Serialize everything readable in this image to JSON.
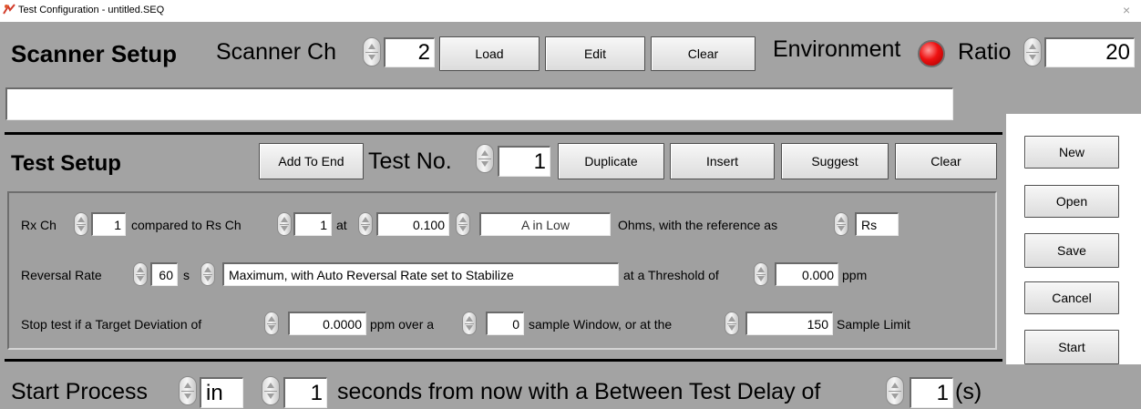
{
  "window": {
    "title": "Test Configuration - untitled.SEQ",
    "close_glyph": "×"
  },
  "scanner_setup": {
    "heading": "Scanner Setup",
    "scanner_ch_label": "Scanner Ch",
    "scanner_ch_value": "2",
    "load_label": "Load",
    "edit_label": "Edit",
    "clear_label": "Clear",
    "environment_label": "Environment",
    "environment_indicator_color": "#ee1111",
    "ratio_label": "Ratio",
    "ratio_value": "20",
    "description_value": ""
  },
  "test_setup": {
    "heading": "Test Setup",
    "add_to_end_label": "Add To End",
    "test_no_label": "Test No.",
    "test_no_value": "1",
    "duplicate_label": "Duplicate",
    "insert_label": "Insert",
    "suggest_label": "Suggest",
    "clear_label": "Clear",
    "row1": {
      "rx_ch_label": "Rx Ch",
      "rx_ch_value": "1",
      "compared_label": "compared to Rs Ch",
      "rs_ch_value": "1",
      "at_label": "at",
      "current_value": "0.100",
      "range_value": "A in Low",
      "ohms_label": "Ohms, with the reference as",
      "reference_value": "Rs"
    },
    "row2": {
      "reversal_rate_label": "Reversal Rate",
      "reversal_rate_value": "60",
      "s_label": "s",
      "mode_value": "Maximum, with Auto Reversal Rate set to Stabilize",
      "threshold_label": "at a Threshold of",
      "threshold_value": "0.000",
      "ppm_label": "ppm"
    },
    "row3": {
      "stop_label": "Stop test if a Target Deviation of",
      "deviation_value": "0.0000",
      "ppm_over_label": "ppm over a",
      "window_value": "0",
      "window_label": "sample Window, or at the",
      "limit_value": "150",
      "limit_label": "Sample Limit"
    }
  },
  "side_buttons": {
    "new_label": "New",
    "open_label": "Open",
    "save_label": "Save",
    "cancel_label": "Cancel",
    "start_label": "Start"
  },
  "start_process": {
    "label": "Start Process",
    "mode_value": "in",
    "seconds_value": "1",
    "middle_label": "seconds from now with a Between Test Delay of",
    "delay_value": "1",
    "unit_label": "(s)"
  }
}
